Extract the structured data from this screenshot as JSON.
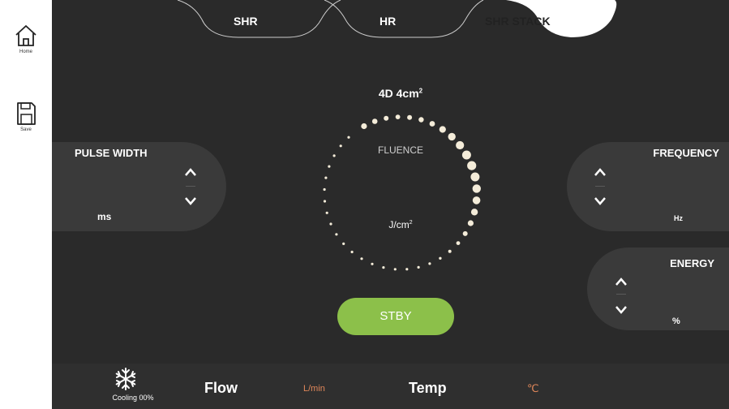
{
  "nav": {
    "home_label": "Home",
    "save_label": "Save"
  },
  "tabs": [
    {
      "label": "SHR",
      "active": false
    },
    {
      "label": "HR",
      "active": false
    },
    {
      "label": "SHR STACK",
      "active": true
    }
  ],
  "mode": {
    "name": "4D 4cm",
    "exponent": "2"
  },
  "fluence": {
    "label": "FLUENCE",
    "unit": "J/cm",
    "unit_exponent": "2"
  },
  "pulse_width": {
    "label": "PULSE WIDTH",
    "unit": "ms"
  },
  "frequency": {
    "label": "FREQUENCY",
    "unit": "Hz"
  },
  "energy": {
    "label": "ENERGY",
    "unit": "%"
  },
  "stby_button": {
    "label": "STBY"
  },
  "status_bar": {
    "cooling_label": "Cooling 00%",
    "flow_label": "Flow",
    "flow_unit": "L/min",
    "temp_label": "Temp",
    "temp_unit": "℃"
  },
  "colors": {
    "background": "#2a2a2a",
    "panel": "#3a3a3a",
    "accent_green": "#8cc04a",
    "unit_orange": "#e0875a",
    "active_tab": "#ffffff"
  }
}
